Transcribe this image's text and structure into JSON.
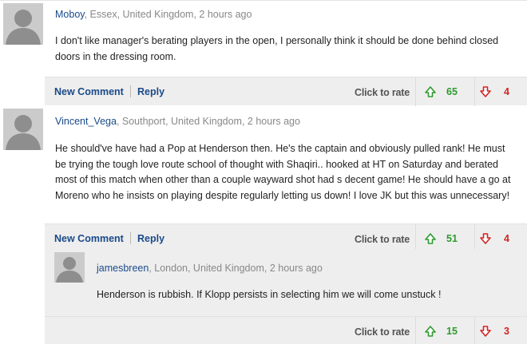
{
  "comments": [
    {
      "author": "Moboy",
      "location": ", Essex, United Kingdom, 2 hours ago",
      "text": "I don't like manager's berating players in the open, I personally think it should be done behind closed doors in the dressing room.",
      "new_comment_label": "New Comment",
      "reply_label": "Reply",
      "rate_label": "Click to rate",
      "up_count": "65",
      "down_count": "4"
    },
    {
      "author": "Vincent_Vega",
      "location": ", Southport, United Kingdom, 2 hours ago",
      "text": "He should've have had a Pop at Henderson then. He's the captain and obviously pulled rank! He must be trying the tough love route school of thought with Shaqiri.. hooked at HT on Saturday and berated most of this match when other than a couple wayward shot had s decent game! He should have a go at Moreno who he insists on playing despite regularly letting us down! I love JK but this was unnecessary!",
      "new_comment_label": "New Comment",
      "reply_label": "Reply",
      "rate_label": "Click to rate",
      "up_count": "51",
      "down_count": "4"
    }
  ],
  "reply": {
    "author": "jamesbreen",
    "location": ", London, United Kingdom, 2 hours ago",
    "text": "Henderson is rubbish. If Klopp persists in selecting him we will come unstuck !",
    "rate_label": "Click to rate",
    "up_count": "15",
    "down_count": "3"
  },
  "icons": {
    "avatar": "avatar-silhouette-icon",
    "up": "arrow-up-icon",
    "down": "arrow-down-icon"
  },
  "colors": {
    "link": "#1a4a8a",
    "up": "#2e9a2e",
    "down": "#d42222",
    "action_bar": "#eeeeee"
  }
}
